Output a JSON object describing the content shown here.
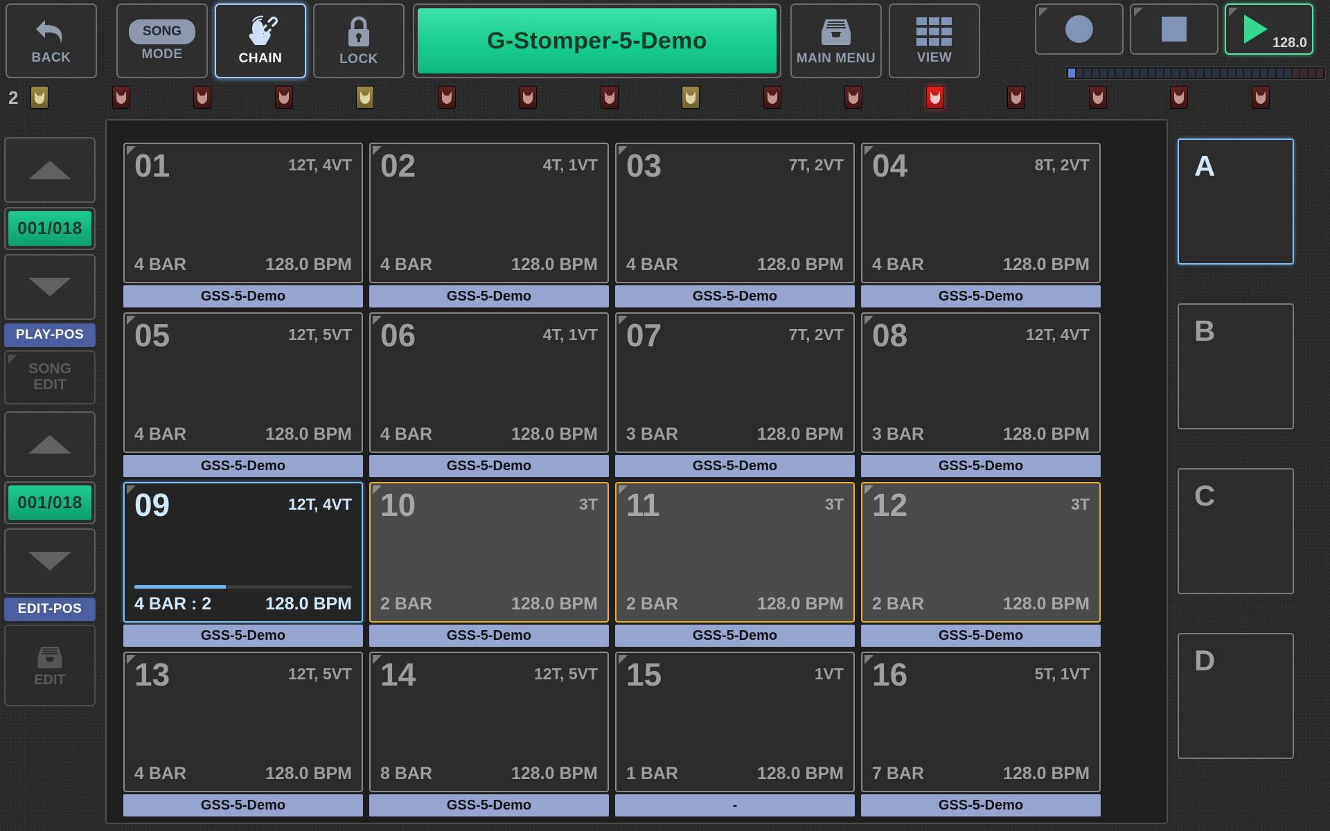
{
  "toolbar": {
    "back": {
      "label": "BACK",
      "icon": "back-arrow-icon"
    },
    "mode": {
      "label": "MODE",
      "pill": "SONG",
      "icon": "song-pill-icon"
    },
    "chain": {
      "label": "CHAIN",
      "icon": "hand-touch-link-icon"
    },
    "lock": {
      "label": "LOCK",
      "icon": "padlock-icon"
    },
    "song_title": "G-Stomper-5-Demo",
    "main_menu": {
      "label": "MAIN MENU",
      "icon": "file-tray-icon"
    },
    "view": {
      "label": "VIEW",
      "icon": "grid-3x3-icon"
    }
  },
  "transport": {
    "record": {
      "icon": "record-circle-icon"
    },
    "stop": {
      "icon": "stop-square-icon"
    },
    "play": {
      "icon": "play-triangle-icon"
    },
    "bpm": "128.0",
    "step_meter": {
      "total": 32,
      "active_index": 0
    }
  },
  "track_row": {
    "number": "2",
    "icons": [
      {
        "name": "track-icon-1",
        "state": "gold"
      },
      {
        "name": "track-icon-2",
        "state": "dark"
      },
      {
        "name": "track-icon-3",
        "state": "dark"
      },
      {
        "name": "track-icon-4",
        "state": "dark"
      },
      {
        "name": "track-icon-5",
        "state": "gold"
      },
      {
        "name": "track-icon-6",
        "state": "dark"
      },
      {
        "name": "track-icon-7",
        "state": "dark"
      },
      {
        "name": "track-icon-8",
        "state": "dark"
      },
      {
        "name": "track-icon-9",
        "state": "gold"
      },
      {
        "name": "track-icon-10",
        "state": "dark"
      },
      {
        "name": "track-icon-11",
        "state": "dark"
      },
      {
        "name": "track-icon-12",
        "state": "red"
      },
      {
        "name": "track-icon-13",
        "state": "dark"
      },
      {
        "name": "track-icon-14",
        "state": "dark"
      },
      {
        "name": "track-icon-15",
        "state": "dark"
      },
      {
        "name": "track-icon-16",
        "state": "dark"
      }
    ]
  },
  "sidebar": {
    "play_up": {
      "icon": "arrow-up-icon"
    },
    "play_pos_value": "001/018",
    "play_down": {
      "icon": "arrow-down-icon"
    },
    "play_pos_label": "PLAY-POS",
    "song_edit_line1": "SONG",
    "song_edit_line2": "EDIT",
    "edit_up": {
      "icon": "arrow-up-icon"
    },
    "edit_pos_value": "001/018",
    "edit_down": {
      "icon": "arrow-down-icon"
    },
    "edit_pos_label": "EDIT-POS",
    "edit_label": "EDIT",
    "edit_icon": "file-tray-icon"
  },
  "scenes": [
    {
      "label": "A",
      "active": true
    },
    {
      "label": "B",
      "active": false
    },
    {
      "label": "C",
      "active": false
    },
    {
      "label": "D",
      "active": false
    }
  ],
  "patterns": [
    {
      "num": "01",
      "tracks": "12T, 4VT",
      "bar": "4 BAR",
      "bpm": "128.0 BPM",
      "name": "GSS-5-Demo",
      "state": "normal"
    },
    {
      "num": "02",
      "tracks": "4T, 1VT",
      "bar": "4 BAR",
      "bpm": "128.0 BPM",
      "name": "GSS-5-Demo",
      "state": "normal"
    },
    {
      "num": "03",
      "tracks": "7T, 2VT",
      "bar": "4 BAR",
      "bpm": "128.0 BPM",
      "name": "GSS-5-Demo",
      "state": "normal"
    },
    {
      "num": "04",
      "tracks": "8T, 2VT",
      "bar": "4 BAR",
      "bpm": "128.0 BPM",
      "name": "GSS-5-Demo",
      "state": "normal"
    },
    {
      "num": "05",
      "tracks": "12T, 5VT",
      "bar": "4 BAR",
      "bpm": "128.0 BPM",
      "name": "GSS-5-Demo",
      "state": "normal"
    },
    {
      "num": "06",
      "tracks": "4T, 1VT",
      "bar": "4 BAR",
      "bpm": "128.0 BPM",
      "name": "GSS-5-Demo",
      "state": "normal"
    },
    {
      "num": "07",
      "tracks": "7T, 2VT",
      "bar": "3 BAR",
      "bpm": "128.0 BPM",
      "name": "GSS-5-Demo",
      "state": "normal"
    },
    {
      "num": "08",
      "tracks": "12T, 4VT",
      "bar": "3 BAR",
      "bpm": "128.0 BPM",
      "name": "GSS-5-Demo",
      "state": "normal"
    },
    {
      "num": "09",
      "tracks": "12T, 4VT",
      "bar": "4 BAR : 2",
      "bpm": "128.0 BPM",
      "name": "GSS-5-Demo",
      "state": "selected",
      "progress": 42
    },
    {
      "num": "10",
      "tracks": "3T",
      "bar": "2 BAR",
      "bpm": "128.0 BPM",
      "name": "GSS-5-Demo",
      "state": "queued"
    },
    {
      "num": "11",
      "tracks": "3T",
      "bar": "2 BAR",
      "bpm": "128.0 BPM",
      "name": "GSS-5-Demo",
      "state": "queued"
    },
    {
      "num": "12",
      "tracks": "3T",
      "bar": "2 BAR",
      "bpm": "128.0 BPM",
      "name": "GSS-5-Demo",
      "state": "queued"
    },
    {
      "num": "13",
      "tracks": "12T, 5VT",
      "bar": "4 BAR",
      "bpm": "128.0 BPM",
      "name": "GSS-5-Demo",
      "state": "normal"
    },
    {
      "num": "14",
      "tracks": "12T, 5VT",
      "bar": "8 BAR",
      "bpm": "128.0 BPM",
      "name": "GSS-5-Demo",
      "state": "normal"
    },
    {
      "num": "15",
      "tracks": "1VT",
      "bar": "1 BAR",
      "bpm": "128.0 BPM",
      "name": "-",
      "state": "normal"
    },
    {
      "num": "16",
      "tracks": "5T, 1VT",
      "bar": "7 BAR",
      "bpm": "128.0 BPM",
      "name": "GSS-5-Demo",
      "state": "normal"
    }
  ],
  "colors": {
    "accent_green": "#17cd8f",
    "accent_blue": "#7cc3f5",
    "accent_yellow": "#e8b320",
    "name_bar": "#95a5d0",
    "tag_blue": "#4a5d9e"
  }
}
